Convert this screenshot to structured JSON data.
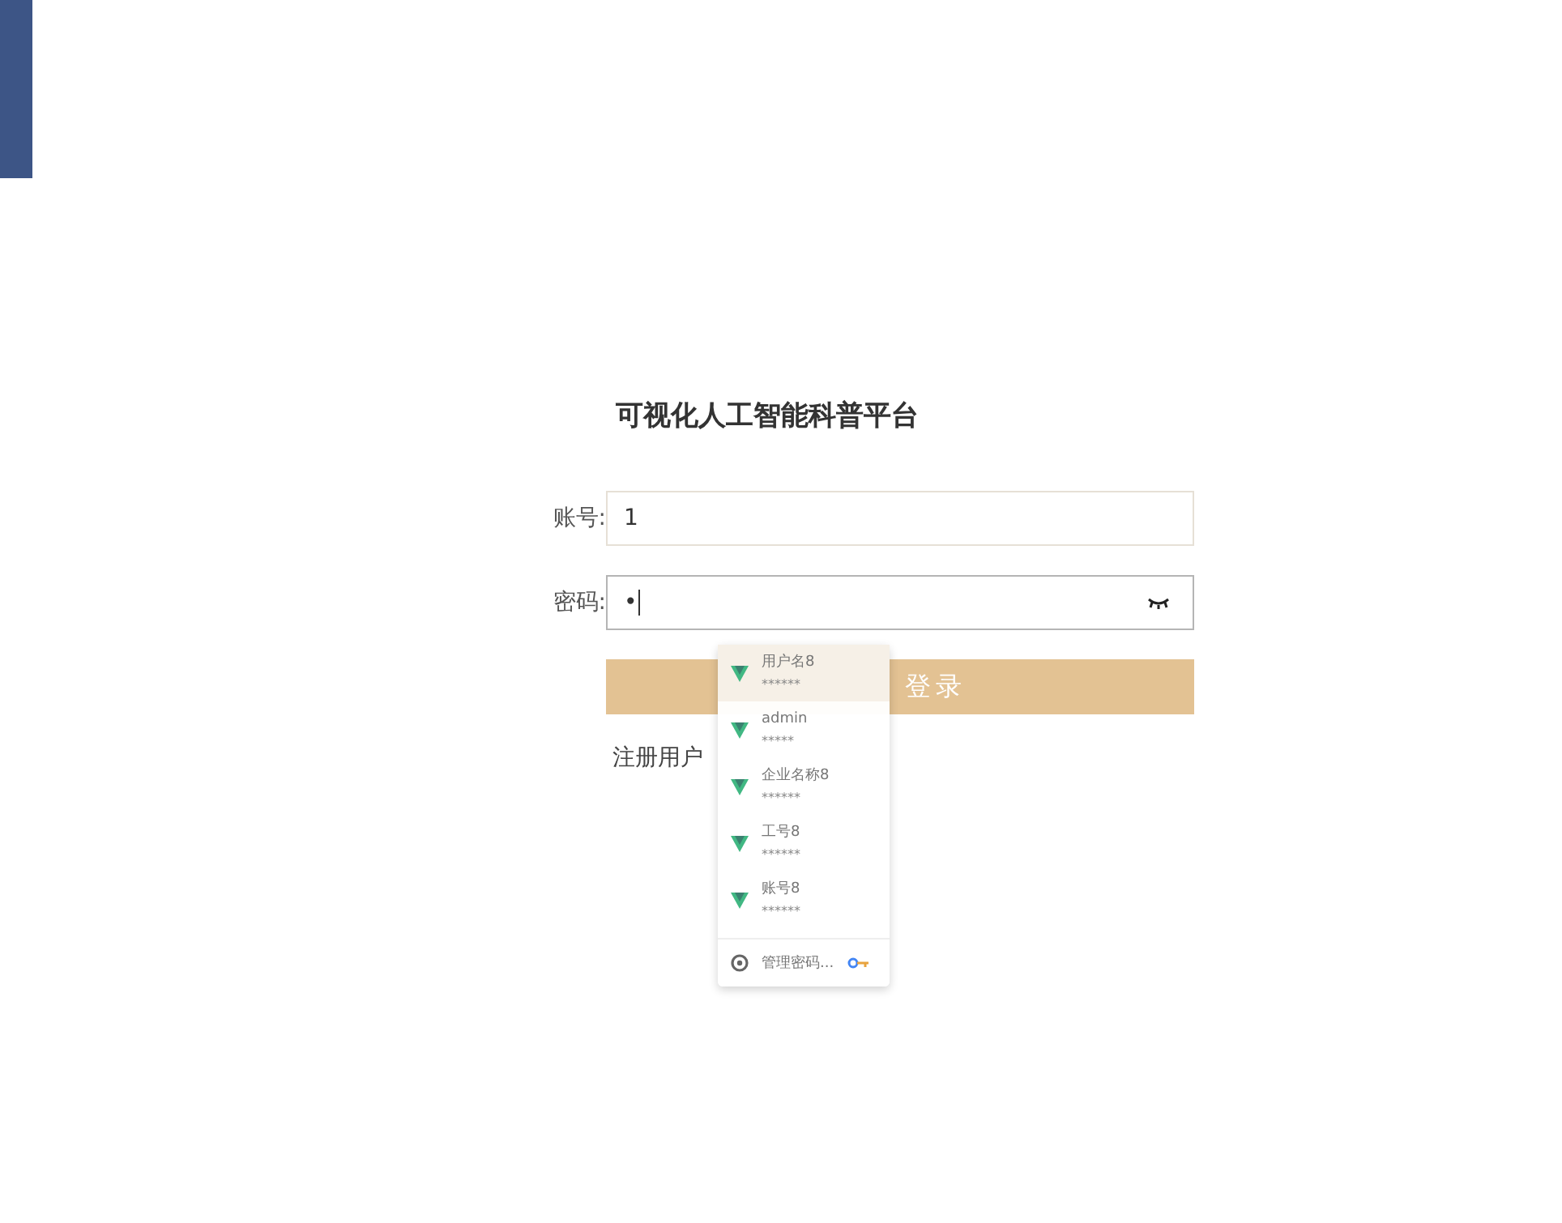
{
  "title": "可视化人工智能科普平台",
  "fields": [
    {
      "label": "账号:",
      "value": "1",
      "kind": "text"
    },
    {
      "label": "密码:",
      "value": "•",
      "kind": "password"
    }
  ],
  "login_button": "登录",
  "register_link": "注册用户",
  "autofill": {
    "items": [
      {
        "username": "用户名8",
        "password": "******",
        "selected": true
      },
      {
        "username": "admin",
        "password": "*****",
        "selected": false
      },
      {
        "username": "企业名称8",
        "password": "******",
        "selected": false
      },
      {
        "username": "工号8",
        "password": "******",
        "selected": false
      },
      {
        "username": "账号8",
        "password": "******",
        "selected": false
      }
    ],
    "manage": "管理密码..."
  }
}
